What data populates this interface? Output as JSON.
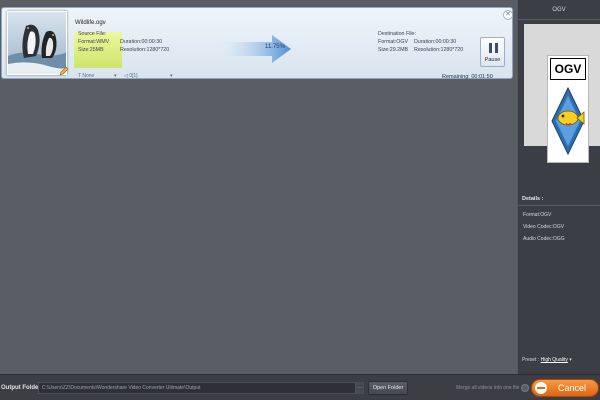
{
  "task": {
    "file_name": "Wildlife.ogv",
    "source": {
      "heading": "Source File:",
      "format": "Format:WMV",
      "size": "Size:25MB",
      "duration": "Duration:00:00:30",
      "resolution": "Resolution:1280*720"
    },
    "progress_text": "11.75%",
    "progress_percent": 11.75,
    "destination": {
      "heading": "Destination File:",
      "format": "Format:OGV",
      "size": "Size:29.2MB",
      "duration": "Duration:00:00:30",
      "resolution": "Resolution:1280*720"
    },
    "pause_label": "Pause",
    "close_glyph": "✕",
    "subtitle_select": "T None",
    "audio_select": "◁ 0[1]",
    "remaining": "Remaining: 00:01:50"
  },
  "panel": {
    "title": "OGV",
    "format_label": "OGV",
    "details_heading": "Details :",
    "details": [
      "Format:OGV",
      "Video Codec:OGV",
      "Audio Codec:OGG"
    ],
    "preset_label": "Preset :",
    "preset_value": "High Quality",
    "preset_caret": "▾"
  },
  "bottom": {
    "output_label": "Output Folder :",
    "output_path": "C:\\Users\\ZZ\\Documents\\Wondershare Video Converter Ultimate\\Output",
    "browse_glyph": "···",
    "open_folder_label": "Open Folder",
    "merge_label": "Merge all videos into one file",
    "cancel_label": "Cancel"
  },
  "colors": {
    "accent_orange": "#e2640f",
    "source_highlight": "#dcef86",
    "progress_blue": "#4d8fd0"
  }
}
